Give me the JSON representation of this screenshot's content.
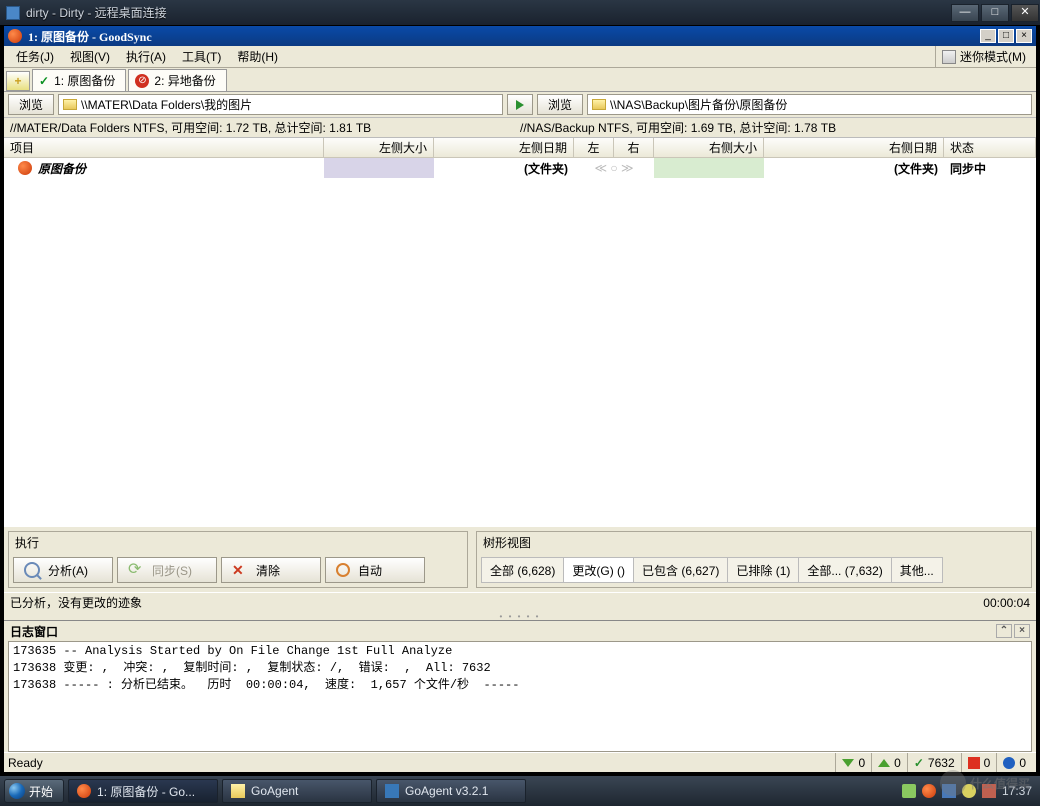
{
  "rdp": {
    "title": "dirty - Dirty - 远程桌面连接"
  },
  "gs": {
    "title": "1: 原图备份 - GoodSync",
    "menu": {
      "job": "任务(J)",
      "view": "视图(V)",
      "run": "执行(A)",
      "tools": "工具(T)",
      "help": "帮助(H)",
      "mini": "迷你模式(M)"
    },
    "tabs": {
      "t1": "1: 原图备份",
      "t2": "2: 异地备份"
    },
    "browse": "浏览",
    "pathLeft": "\\\\MATER\\Data Folders\\我的图片",
    "pathRight": "\\\\NAS\\Backup\\图片备份\\原图备份",
    "infoLeft": "//MATER/Data Folders NTFS, 可用空间: 1.72 TB, 总计空间: 1.81 TB",
    "infoRight": "//NAS/Backup NTFS, 可用空间: 1.69 TB, 总计空间: 1.78 TB",
    "cols": {
      "item": "项目",
      "lsize": "左侧大小",
      "ldate": "左侧日期",
      "left": "左",
      "right": "右",
      "rsize": "右侧大小",
      "rdate": "右侧日期",
      "status": "状态"
    },
    "row": {
      "name": "原图备份",
      "ldate": "(文件夹)",
      "rdate": "(文件夹)",
      "status": "同步中"
    },
    "exec": {
      "title": "执行",
      "analyze": "分析(A)",
      "sync": "同步(S)",
      "clear": "清除",
      "auto": "自动"
    },
    "tree": {
      "title": "树形视图",
      "all": "全部 (6,628)",
      "changes": "更改(G) ()",
      "included": "已包含 (6,627)",
      "excluded": "已排除 (1)",
      "all2": "全部... (7,632)",
      "other": "其他..."
    },
    "statusLine": "已分析，没有更改的迹象",
    "timer": "00:00:04",
    "log": {
      "title": "日志窗口",
      "text": "173635 -- Analysis Started by On File Change 1st Full Analyze\n173638 变更: ,  冲突: ,  复制时间: ,  复制状态: /,  错误:  ,  All: 7632\n173638 ----- : 分析已结束。  历时  00:00:04,  速度:  1,657 个文件/秒  -----"
    },
    "bottom": {
      "ready": "Ready",
      "c1": "0",
      "c2": "7632",
      "c3": "0",
      "c4": "0"
    }
  },
  "taskbar": {
    "start": "开始",
    "t1": "1: 原图备份 - Go...",
    "t2": "GoAgent",
    "t3": "GoAgent v3.2.1",
    "time": "17:37"
  },
  "watermark": "什么值得买"
}
